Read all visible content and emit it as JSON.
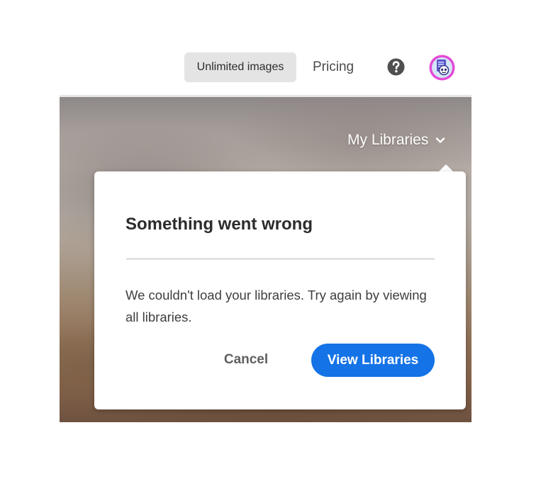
{
  "header": {
    "unlimited_label": "Unlimited images",
    "pricing_label": "Pricing",
    "help_icon": "help-icon",
    "avatar_icon": "avatar"
  },
  "hero": {
    "libraries_label": "My Libraries",
    "chevron_icon": "chevron-down-icon"
  },
  "dialog": {
    "title": "Something went wrong",
    "message": "We couldn't load your libraries. Try again by viewing all libraries.",
    "cancel_label": "Cancel",
    "confirm_label": "View Libraries"
  },
  "colors": {
    "accent": "#1473e6",
    "unlimited_bg": "#e4e4e4",
    "avatar_ring": "#e34bd6"
  }
}
